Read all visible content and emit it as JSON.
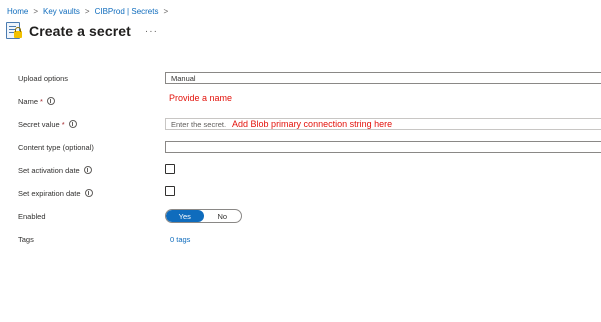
{
  "breadcrumb": {
    "items": [
      "Home",
      "Key vaults",
      "CIBProd | Secrets"
    ],
    "separator": ">"
  },
  "header": {
    "title": "Create a secret",
    "more": "···",
    "icon": "key-vault-secret-icon"
  },
  "form": {
    "upload_options": {
      "label": "Upload options",
      "value": "Manual"
    },
    "name": {
      "label": "Name",
      "required_mark": "*",
      "annotation": "Provide a name"
    },
    "secret_value": {
      "label": "Secret value",
      "required_mark": "*",
      "placeholder": "Enter the secret.",
      "annotation": "Add Blob primary connection string here"
    },
    "content_type": {
      "label": "Content type (optional)",
      "value": ""
    },
    "activation_date": {
      "label": "Set activation date",
      "checked": false
    },
    "expiration_date": {
      "label": "Set expiration date",
      "checked": false
    },
    "enabled": {
      "label": "Enabled",
      "on_label": "Yes",
      "off_label": "No",
      "selected": "Yes"
    },
    "tags": {
      "label": "Tags",
      "link": "0 tags"
    }
  },
  "colors": {
    "accent": "#0f6cbd",
    "annotation": "#e3120b",
    "required": "#a4262c"
  }
}
